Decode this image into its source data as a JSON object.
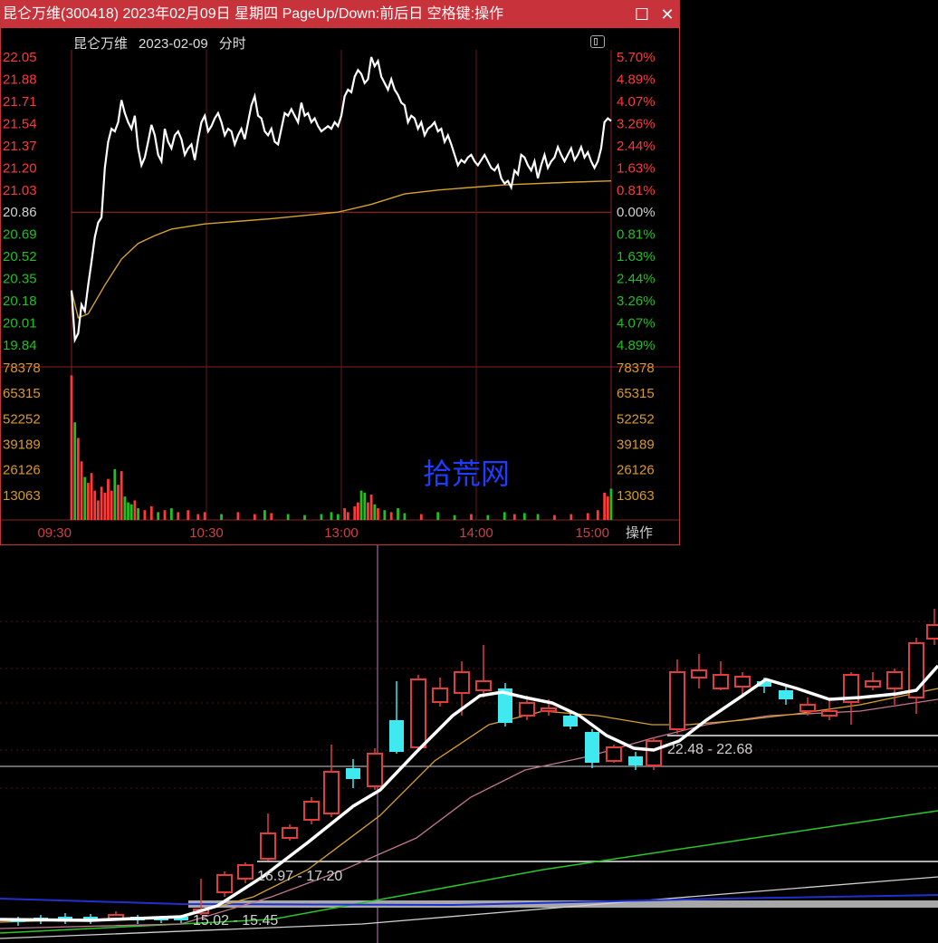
{
  "window": {
    "title": "昆仑万维(300418) 2023年02月09日 星期四 PageUp/Down:前后日 空格键:操作",
    "maximize_icon": "square-icon",
    "close_icon": "x-icon"
  },
  "header": {
    "stock_name": "昆仑万维",
    "date": "2023-02-09",
    "mode": "分时"
  },
  "watermark": "拾荒网",
  "op_button_label": "操作",
  "colors": {
    "title_bar": "#c8323a",
    "up": "#ff3838",
    "down": "#20c020",
    "price_line": "#ffffff",
    "avg_line": "#d8a32c",
    "kline_up": "#e23c3c",
    "kline_down": "#40e8f0"
  },
  "chart_data": [
    {
      "type": "line",
      "name_hint": "intraday",
      "prev_close": 20.86,
      "ylim": [
        19.84,
        22.05
      ],
      "price_ticks": [
        "22.05",
        "21.88",
        "21.71",
        "21.54",
        "21.37",
        "21.20",
        "21.03",
        "20.86",
        "20.69",
        "20.52",
        "20.35",
        "20.18",
        "20.01",
        "19.84"
      ],
      "pct_ticks": [
        "5.70%",
        "4.89%",
        "4.07%",
        "3.26%",
        "2.44%",
        "1.63%",
        "0.81%",
        "0.00%",
        "0.81%",
        "1.63%",
        "2.44%",
        "3.26%",
        "4.07%",
        "4.89%"
      ],
      "volume_ticks": [
        "78378",
        "65315",
        "52252",
        "39189",
        "26126",
        "13063"
      ],
      "x_ticks": [
        "09:30",
        "10:30",
        "13:00",
        "14:00",
        "15:00"
      ],
      "price": [
        [
          0,
          20.26
        ],
        [
          1,
          19.88
        ],
        [
          2,
          19.93
        ],
        [
          3,
          20.15
        ],
        [
          4,
          20.1
        ],
        [
          5,
          20.3
        ],
        [
          6,
          20.48
        ],
        [
          7,
          20.67
        ],
        [
          8,
          20.78
        ],
        [
          9,
          20.82
        ],
        [
          10,
          21.2
        ],
        [
          11,
          21.4
        ],
        [
          12,
          21.5
        ],
        [
          13,
          21.48
        ],
        [
          14,
          21.55
        ],
        [
          15,
          21.72
        ],
        [
          16,
          21.62
        ],
        [
          17,
          21.55
        ],
        [
          18,
          21.5
        ],
        [
          19,
          21.6
        ],
        [
          20,
          21.35
        ],
        [
          21,
          21.22
        ],
        [
          22,
          21.28
        ],
        [
          23,
          21.4
        ],
        [
          24,
          21.53
        ],
        [
          25,
          21.45
        ],
        [
          26,
          21.3
        ],
        [
          27,
          21.25
        ],
        [
          28,
          21.5
        ],
        [
          29,
          21.4
        ],
        [
          30,
          21.35
        ],
        [
          31,
          21.45
        ],
        [
          32,
          21.48
        ],
        [
          33,
          21.42
        ],
        [
          34,
          21.3
        ],
        [
          35,
          21.35
        ],
        [
          36,
          21.38
        ],
        [
          37,
          21.26
        ],
        [
          38,
          21.42
        ],
        [
          39,
          21.55
        ],
        [
          40,
          21.6
        ],
        [
          41,
          21.48
        ],
        [
          42,
          21.52
        ],
        [
          43,
          21.58
        ],
        [
          44,
          21.62
        ],
        [
          45,
          21.55
        ],
        [
          46,
          21.45
        ],
        [
          47,
          21.5
        ],
        [
          48,
          21.48
        ],
        [
          49,
          21.38
        ],
        [
          50,
          21.45
        ],
        [
          51,
          21.5
        ],
        [
          52,
          21.42
        ],
        [
          53,
          21.55
        ],
        [
          54,
          21.68
        ],
        [
          55,
          21.75
        ],
        [
          56,
          21.6
        ],
        [
          57,
          21.58
        ],
        [
          58,
          21.48
        ],
        [
          59,
          21.45
        ],
        [
          60,
          21.5
        ],
        [
          61,
          21.4
        ],
        [
          62,
          21.38
        ],
        [
          63,
          21.5
        ],
        [
          64,
          21.62
        ],
        [
          65,
          21.6
        ],
        [
          66,
          21.65
        ],
        [
          67,
          21.6
        ],
        [
          68,
          21.55
        ],
        [
          69,
          21.7
        ],
        [
          70,
          21.6
        ],
        [
          71,
          21.62
        ],
        [
          72,
          21.55
        ],
        [
          73,
          21.58
        ],
        [
          74,
          21.52
        ],
        [
          75,
          21.48
        ],
        [
          76,
          21.5
        ],
        [
          77,
          21.52
        ],
        [
          78,
          21.5
        ],
        [
          79,
          21.55
        ],
        [
          80,
          21.52
        ],
        [
          81,
          21.6
        ],
        [
          82,
          21.75
        ],
        [
          83,
          21.8
        ],
        [
          84,
          21.78
        ],
        [
          85,
          21.9
        ],
        [
          86,
          21.95
        ],
        [
          87,
          21.92
        ],
        [
          88,
          21.85
        ],
        [
          89,
          21.88
        ],
        [
          90,
          22.05
        ],
        [
          91,
          21.98
        ],
        [
          92,
          22.02
        ],
        [
          93,
          21.9
        ],
        [
          94,
          21.85
        ],
        [
          95,
          21.8
        ],
        [
          96,
          21.88
        ],
        [
          97,
          21.8
        ],
        [
          98,
          21.76
        ],
        [
          99,
          21.7
        ],
        [
          100,
          21.68
        ],
        [
          101,
          21.55
        ],
        [
          102,
          21.6
        ],
        [
          103,
          21.58
        ],
        [
          104,
          21.5
        ],
        [
          105,
          21.55
        ],
        [
          106,
          21.45
        ],
        [
          107,
          21.5
        ],
        [
          108,
          21.52
        ],
        [
          109,
          21.55
        ],
        [
          110,
          21.48
        ],
        [
          111,
          21.5
        ],
        [
          112,
          21.4
        ],
        [
          113,
          21.45
        ],
        [
          114,
          21.38
        ],
        [
          115,
          21.3
        ],
        [
          116,
          21.22
        ],
        [
          117,
          21.26
        ],
        [
          118,
          21.24
        ],
        [
          119,
          21.28
        ],
        [
          120,
          21.3
        ],
        [
          121,
          21.25
        ],
        [
          122,
          21.22
        ],
        [
          123,
          21.26
        ],
        [
          124,
          21.3
        ],
        [
          125,
          21.25
        ],
        [
          126,
          21.2
        ],
        [
          127,
          21.18
        ],
        [
          128,
          21.22
        ],
        [
          129,
          21.12
        ],
        [
          130,
          21.08
        ],
        [
          131,
          21.1
        ],
        [
          132,
          21.05
        ],
        [
          133,
          21.18
        ],
        [
          134,
          21.15
        ],
        [
          135,
          21.3
        ],
        [
          136,
          21.28
        ],
        [
          137,
          21.22
        ],
        [
          138,
          21.18
        ],
        [
          139,
          21.25
        ],
        [
          140,
          21.12
        ],
        [
          141,
          21.22
        ],
        [
          142,
          21.3
        ],
        [
          143,
          21.2
        ],
        [
          144,
          21.25
        ],
        [
          145,
          21.28
        ],
        [
          146,
          21.36
        ],
        [
          147,
          21.3
        ],
        [
          148,
          21.25
        ],
        [
          149,
          21.3
        ],
        [
          150,
          21.35
        ],
        [
          151,
          21.26
        ],
        [
          152,
          21.3
        ],
        [
          153,
          21.36
        ],
        [
          154,
          21.28
        ],
        [
          155,
          21.32
        ],
        [
          156,
          21.25
        ],
        [
          157,
          21.2
        ],
        [
          158,
          21.25
        ],
        [
          159,
          21.35
        ],
        [
          160,
          21.55
        ],
        [
          161,
          21.58
        ],
        [
          162,
          21.56
        ]
      ],
      "avg": [
        [
          0,
          20.26
        ],
        [
          2,
          20.05
        ],
        [
          5,
          20.08
        ],
        [
          10,
          20.3
        ],
        [
          15,
          20.5
        ],
        [
          20,
          20.62
        ],
        [
          25,
          20.68
        ],
        [
          30,
          20.73
        ],
        [
          40,
          20.77
        ],
        [
          60,
          20.81
        ],
        [
          80,
          20.86
        ],
        [
          90,
          20.92
        ],
        [
          100,
          21.0
        ],
        [
          110,
          21.03
        ],
        [
          130,
          21.07
        ],
        [
          150,
          21.09
        ],
        [
          162,
          21.1
        ]
      ],
      "volume": [
        [
          0,
          74000
        ],
        [
          1,
          50000
        ],
        [
          2,
          42000
        ],
        [
          3,
          30000
        ],
        [
          4,
          22000
        ],
        [
          5,
          19000
        ],
        [
          6,
          24000
        ],
        [
          7,
          15000
        ],
        [
          8,
          10000
        ],
        [
          9,
          17000
        ],
        [
          10,
          14000
        ],
        [
          11,
          21000
        ],
        [
          12,
          15000
        ],
        [
          13,
          26000
        ],
        [
          14,
          18000
        ],
        [
          15,
          25000
        ],
        [
          16,
          12000
        ],
        [
          17,
          9000
        ],
        [
          18,
          8000
        ],
        [
          19,
          10000
        ],
        [
          20,
          6000
        ],
        [
          22,
          5000
        ],
        [
          24,
          7000
        ],
        [
          26,
          4000
        ],
        [
          28,
          5000
        ],
        [
          30,
          6000
        ],
        [
          32,
          4000
        ],
        [
          35,
          5000
        ],
        [
          38,
          3000
        ],
        [
          40,
          4000
        ],
        [
          45,
          3000
        ],
        [
          50,
          4000
        ],
        [
          55,
          3000
        ],
        [
          58,
          5000
        ],
        [
          60,
          3500
        ],
        [
          65,
          3000
        ],
        [
          70,
          2500
        ],
        [
          75,
          3000
        ],
        [
          78,
          4000
        ],
        [
          80,
          3000
        ],
        [
          82,
          6000
        ],
        [
          83,
          4000
        ],
        [
          85,
          7000
        ],
        [
          86,
          9000
        ],
        [
          87,
          15000
        ],
        [
          88,
          14000
        ],
        [
          89,
          9000
        ],
        [
          90,
          13000
        ],
        [
          91,
          8000
        ],
        [
          92,
          6000
        ],
        [
          94,
          5000
        ],
        [
          96,
          4000
        ],
        [
          98,
          6000
        ],
        [
          100,
          3500
        ],
        [
          105,
          3000
        ],
        [
          110,
          4000
        ],
        [
          115,
          2500
        ],
        [
          120,
          3000
        ],
        [
          125,
          2500
        ],
        [
          130,
          4000
        ],
        [
          133,
          3000
        ],
        [
          136,
          3500
        ],
        [
          140,
          3000
        ],
        [
          145,
          2500
        ],
        [
          150,
          3000
        ],
        [
          155,
          3500
        ],
        [
          158,
          5000
        ],
        [
          160,
          14000
        ],
        [
          161,
          12000
        ],
        [
          162,
          16000
        ]
      ]
    },
    {
      "type": "candlestick",
      "name_hint": "daily",
      "ranges": [
        "22.48 - 22.68",
        "16.97 - 17.20",
        "15.02 - 15.45"
      ]
    }
  ]
}
